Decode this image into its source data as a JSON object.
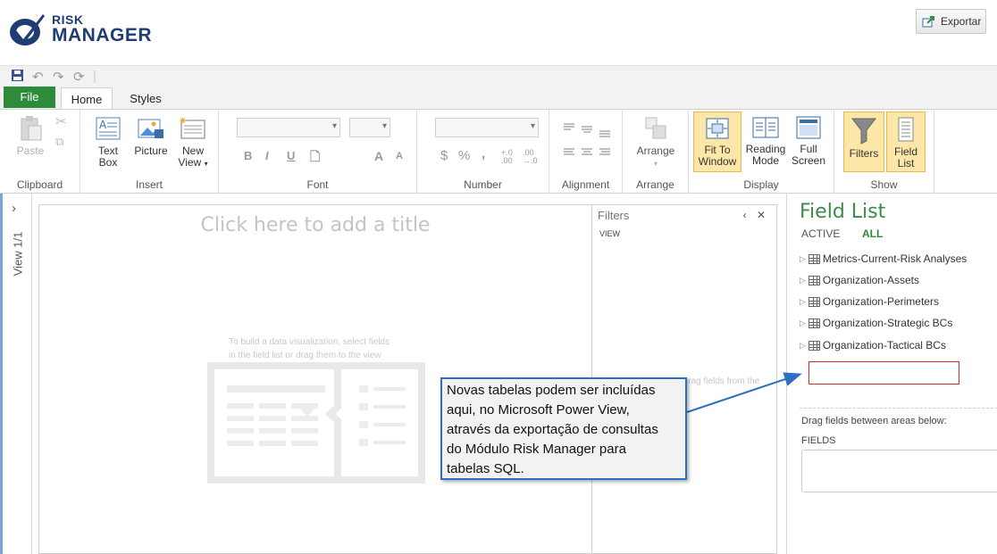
{
  "brand": {
    "line1": "RISK",
    "line2": "MANAGER",
    "color": "#1f3c73"
  },
  "header": {
    "export_label": "Exportar"
  },
  "ribbon_tabs": {
    "file": "File",
    "home": "Home",
    "styles": "Styles"
  },
  "ribbon": {
    "clipboard": {
      "paste": "Paste",
      "group": "Clipboard"
    },
    "insert": {
      "text_box_1": "Text",
      "text_box_2": "Box",
      "picture": "Picture",
      "new_view_1": "New",
      "new_view_2": "View",
      "group": "Insert"
    },
    "font": {
      "bold": "B",
      "italic": "I",
      "underline": "U",
      "grow": "A",
      "shrink": "A",
      "group": "Font"
    },
    "number": {
      "currency": "$",
      "percent": "%",
      "comma": ",",
      "inc_dec": "+.0 .00",
      "dec_dec": ".00 →.0",
      "group": "Number"
    },
    "alignment": {
      "group": "Alignment"
    },
    "arrange": {
      "arrange": "Arrange",
      "group": "Arrange"
    },
    "display": {
      "fit_1": "Fit To",
      "fit_2": "Window",
      "reading_1": "Reading",
      "reading_2": "Mode",
      "full_1": "Full",
      "full_2": "Screen",
      "group": "Display"
    },
    "show": {
      "filters": "Filters",
      "field_1": "Field",
      "field_2": "List",
      "group": "Show"
    }
  },
  "view_strip": {
    "label": "View 1/1"
  },
  "canvas": {
    "title_placeholder": "Click here to add a title",
    "hint_line1": "To build a data visualization, select fields",
    "hint_line2": "in the field list or drag them to the view"
  },
  "filters": {
    "title": "Filters",
    "view_tab": "VIEW",
    "hint": "Drag fields from the"
  },
  "field_list": {
    "title": "Field List",
    "tab_active": "ACTIVE",
    "tab_all": "ALL",
    "items": [
      "Metrics-Current-Risk Analyses",
      "Organization-Assets",
      "Organization-Perimeters",
      "Organization-Strategic BCs",
      "Organization-Tactical BCs"
    ],
    "drag_label": "Drag fields between areas below:",
    "fields_label": "FIELDS"
  },
  "callout": {
    "lines": [
      "Novas tabelas podem ser incluídas",
      "aqui, no Microsoft Power View,",
      "através da exportação de consultas",
      "do Módulo Risk Manager para",
      "tabelas SQL."
    ],
    "border_color": "#2e6fc4"
  }
}
